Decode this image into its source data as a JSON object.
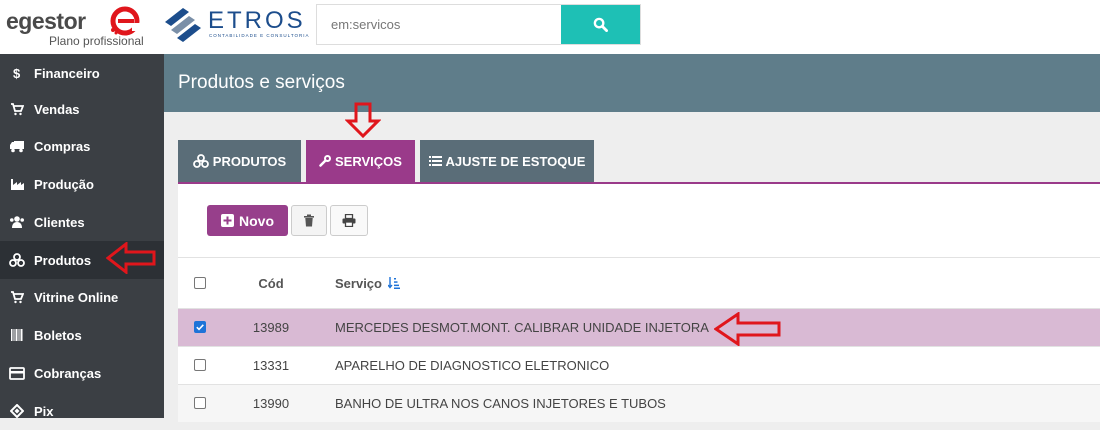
{
  "topbar": {
    "brand": "egestor",
    "plan": "Plano profissional",
    "partner_name": "ETROS",
    "partner_sub": "CONTABILIDADE E CONSULTORIA",
    "search_value": "em:servicos",
    "search_icon": "search-icon"
  },
  "sidebar": {
    "items": [
      {
        "label": "Financeiro",
        "icon": "dollar-icon"
      },
      {
        "label": "Vendas",
        "icon": "cart-icon"
      },
      {
        "label": "Compras",
        "icon": "truck-icon"
      },
      {
        "label": "Produção",
        "icon": "factory-icon"
      },
      {
        "label": "Clientes",
        "icon": "users-icon"
      },
      {
        "label": "Produtos",
        "icon": "cubes-icon"
      },
      {
        "label": "Vitrine Online",
        "icon": "cart-icon"
      },
      {
        "label": "Boletos",
        "icon": "barcode-icon"
      },
      {
        "label": "Cobranças",
        "icon": "credit-card-icon"
      },
      {
        "label": "Pix",
        "icon": "pix-icon"
      }
    ],
    "active": "Produtos"
  },
  "page": {
    "title": "Produtos e serviços"
  },
  "tabs": [
    {
      "label": "PRODUTOS",
      "icon": "cubes-icon"
    },
    {
      "label": "SERVIÇOS",
      "icon": "wrench-icon"
    },
    {
      "label": "AJUSTE DE ESTOQUE",
      "icon": "list-icon"
    }
  ],
  "active_tab": "SERVIÇOS",
  "toolbar": {
    "new_label": "Novo",
    "delete_icon": "trash-icon",
    "print_icon": "print-icon"
  },
  "table": {
    "headers": {
      "cod": "Cód",
      "service": "Serviço"
    },
    "rows": [
      {
        "cod": "13989",
        "service": "MERCEDES DESMOT.MONT. CALIBRAR UNIDADE INJETORA",
        "checked": true
      },
      {
        "cod": "13331",
        "service": "APARELHO DE DIAGNOSTICO ELETRONICO",
        "checked": false
      },
      {
        "cod": "13990",
        "service": "BANHO DE ULTRA NOS CANOS INJETORES E TUBOS",
        "checked": false
      }
    ]
  },
  "colors": {
    "accent_purple": "#9a3a8a",
    "sidebar_bg": "#3b3f44",
    "header_bg": "#5f7d8a",
    "search_button": "#1ec0b5",
    "selected_row": "#d9bad4",
    "annotation_arrow": "#e0161c"
  }
}
